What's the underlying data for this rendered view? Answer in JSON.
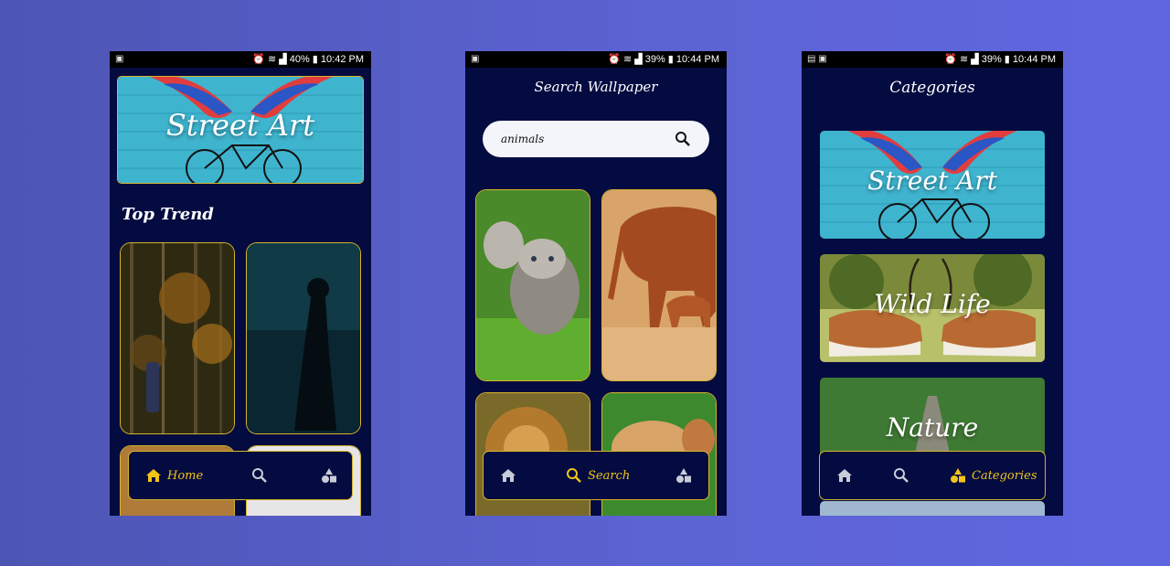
{
  "colors": {
    "background": "#5c63d2",
    "screen_bg": "#030b40",
    "accent_gold": "#f2c418",
    "border_gold": "#d6b52a",
    "icon_inactive": "#c9ccd8"
  },
  "phones": [
    {
      "status": {
        "right": "40% ▮ 10:42 PM"
      },
      "banner": {
        "label": "Street Art"
      },
      "section_title": "Top Trend",
      "nav": {
        "active": "home",
        "home_label": "Home"
      }
    },
    {
      "status": {
        "right": "39% ▮ 10:44 PM"
      },
      "title": "Search Wallpaper",
      "search": {
        "value": "animals"
      },
      "nav": {
        "active": "search",
        "search_label": "Search"
      }
    },
    {
      "status": {
        "right": "39% ▮ 10:44 PM"
      },
      "title": "Categories",
      "categories": [
        {
          "label": "Street Art"
        },
        {
          "label": "Wild Life"
        },
        {
          "label": "Nature"
        }
      ],
      "nav": {
        "active": "categories",
        "categories_label": "Categories"
      }
    }
  ],
  "icons": {
    "status_left": "sim-icon",
    "status_indicators": "alarm wifi nfc signal battery icons"
  }
}
